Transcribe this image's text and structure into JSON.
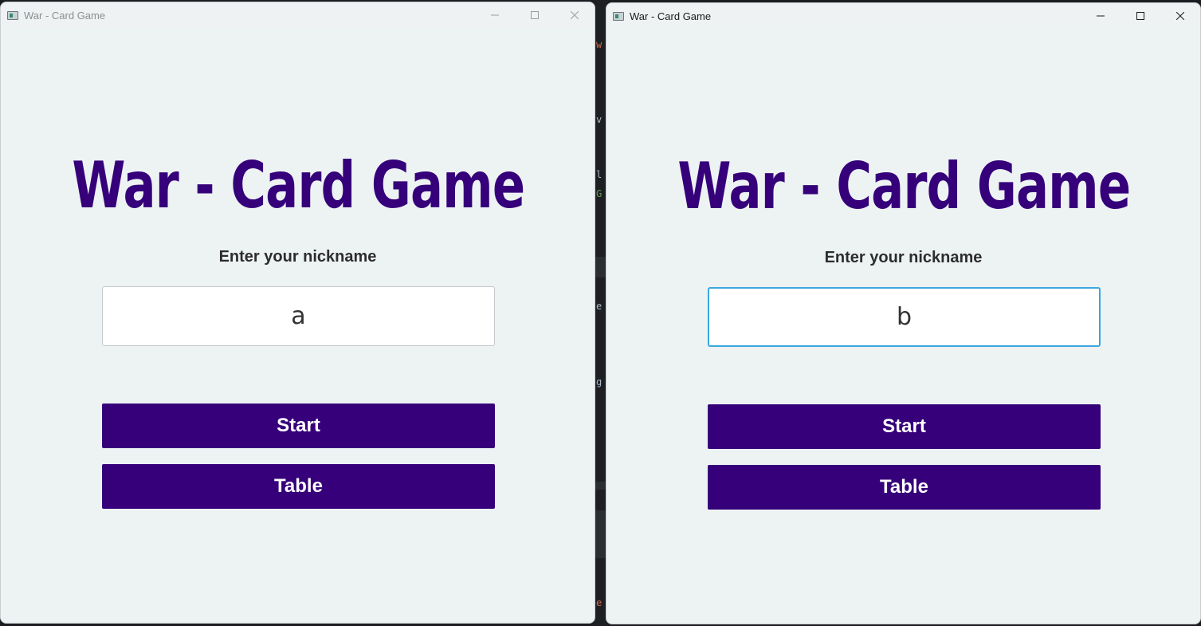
{
  "windows": [
    {
      "title": "War - Card Game",
      "heading": "War - Card Game",
      "prompt": "Enter your nickname",
      "nickname_value": "a",
      "start_label": "Start",
      "table_label": "Table",
      "focused_input": false
    },
    {
      "title": "War - Card Game",
      "heading": "War - Card Game",
      "prompt": "Enter your nickname",
      "nickname_value": "b",
      "start_label": "Start",
      "table_label": "Table",
      "focused_input": true
    }
  ],
  "icons": {
    "app": "app-window-icon",
    "minimize": "minimize-icon",
    "maximize": "maximize-icon",
    "close": "close-icon"
  },
  "colors": {
    "accent": "#36007a",
    "window_bg": "#edf2f3",
    "focus_ring": "#3ba7df",
    "button_text": "#ffffff"
  },
  "background_fragments": [
    "w",
    "v",
    "l",
    "G",
    "e",
    "g",
    "e"
  ]
}
